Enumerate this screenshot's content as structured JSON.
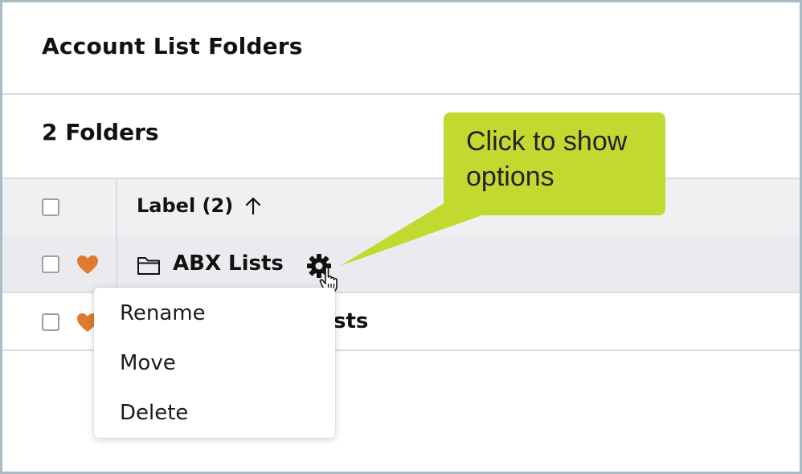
{
  "page": {
    "title": "Account List Folders",
    "folder_count": "2 Folders"
  },
  "table": {
    "column_label": "Label (2)",
    "rows": [
      {
        "label": "ABX Lists",
        "favorite": true,
        "icon": "folder-icon"
      },
      {
        "label": "sts",
        "favorite": true
      }
    ]
  },
  "context_menu": {
    "items": [
      "Rename",
      "Move",
      "Delete"
    ]
  },
  "callout": {
    "text": "Click to show options"
  },
  "colors": {
    "heart": "#e07a2e",
    "callout": "#c2d930",
    "frame": "#a9bcc6"
  }
}
